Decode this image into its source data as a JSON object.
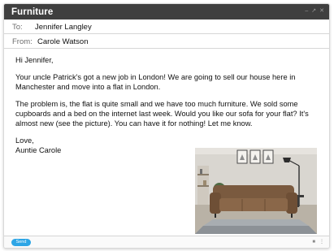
{
  "window": {
    "title": "Furniture",
    "controls": [
      "–",
      "↗",
      "✕"
    ]
  },
  "header": {
    "to_label": "To:",
    "to_value": "Jennifer Langley",
    "from_label": "From:",
    "from_value": "Carole Watson"
  },
  "message": {
    "greeting": "Hi Jennifer,",
    "paragraph1": "Your uncle Patrick's got a new job in London! We are going to sell our house here in Manchester and move into a flat in London.",
    "paragraph2": "The problem is, the flat is quite small and we have too much furniture. We sold some cupboards and a bed on the internet last week. Would you like our sofa for your flat? It's almost new (see the picture). You can have it for nothing! Let me know.",
    "signoff": "Love,",
    "signature": "Auntie Carole"
  },
  "footer": {
    "send_label": "Send",
    "icons": [
      "trash-icon",
      "more-icon"
    ]
  },
  "colors": {
    "titlebar": "#3f3f3f",
    "send_button": "#2ea6e6",
    "divider": "#d6d6d6"
  }
}
